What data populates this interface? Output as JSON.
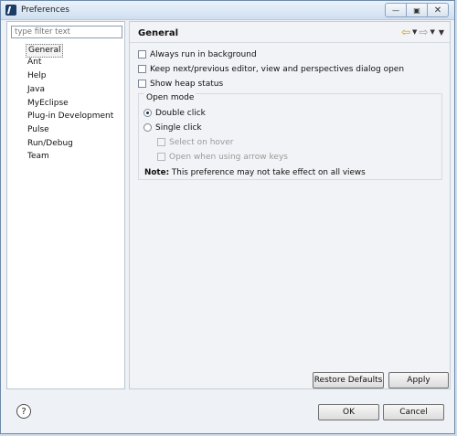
{
  "window": {
    "title": "Preferences"
  },
  "left": {
    "filter_placeholder": "type filter text",
    "items": [
      "General",
      "Ant",
      "Help",
      "Java",
      "MyEclipse",
      "Plug-in Development",
      "Pulse",
      "Run/Debug",
      "Team"
    ],
    "selected": "General"
  },
  "right": {
    "title": "General",
    "checkboxes": [
      {
        "label": "Always run in background",
        "checked": false
      },
      {
        "label": "Keep next/previous editor, view and perspectives dialog open",
        "checked": false
      },
      {
        "label": "Show heap status",
        "checked": false
      }
    ],
    "open_mode": {
      "title": "Open mode",
      "options": [
        {
          "label": "Double click",
          "checked": true
        },
        {
          "label": "Single click",
          "checked": false
        }
      ],
      "sub_options": [
        {
          "label": "Select on hover",
          "checked": false,
          "enabled": false
        },
        {
          "label": "Open when using arrow keys",
          "checked": false,
          "enabled": false
        }
      ],
      "note_label": "Note:",
      "note_text": "This preference may not take effect on all views"
    },
    "buttons": {
      "restore_defaults": "Restore Defaults",
      "apply": "Apply"
    }
  },
  "bottom": {
    "ok": "OK",
    "cancel": "Cancel"
  }
}
